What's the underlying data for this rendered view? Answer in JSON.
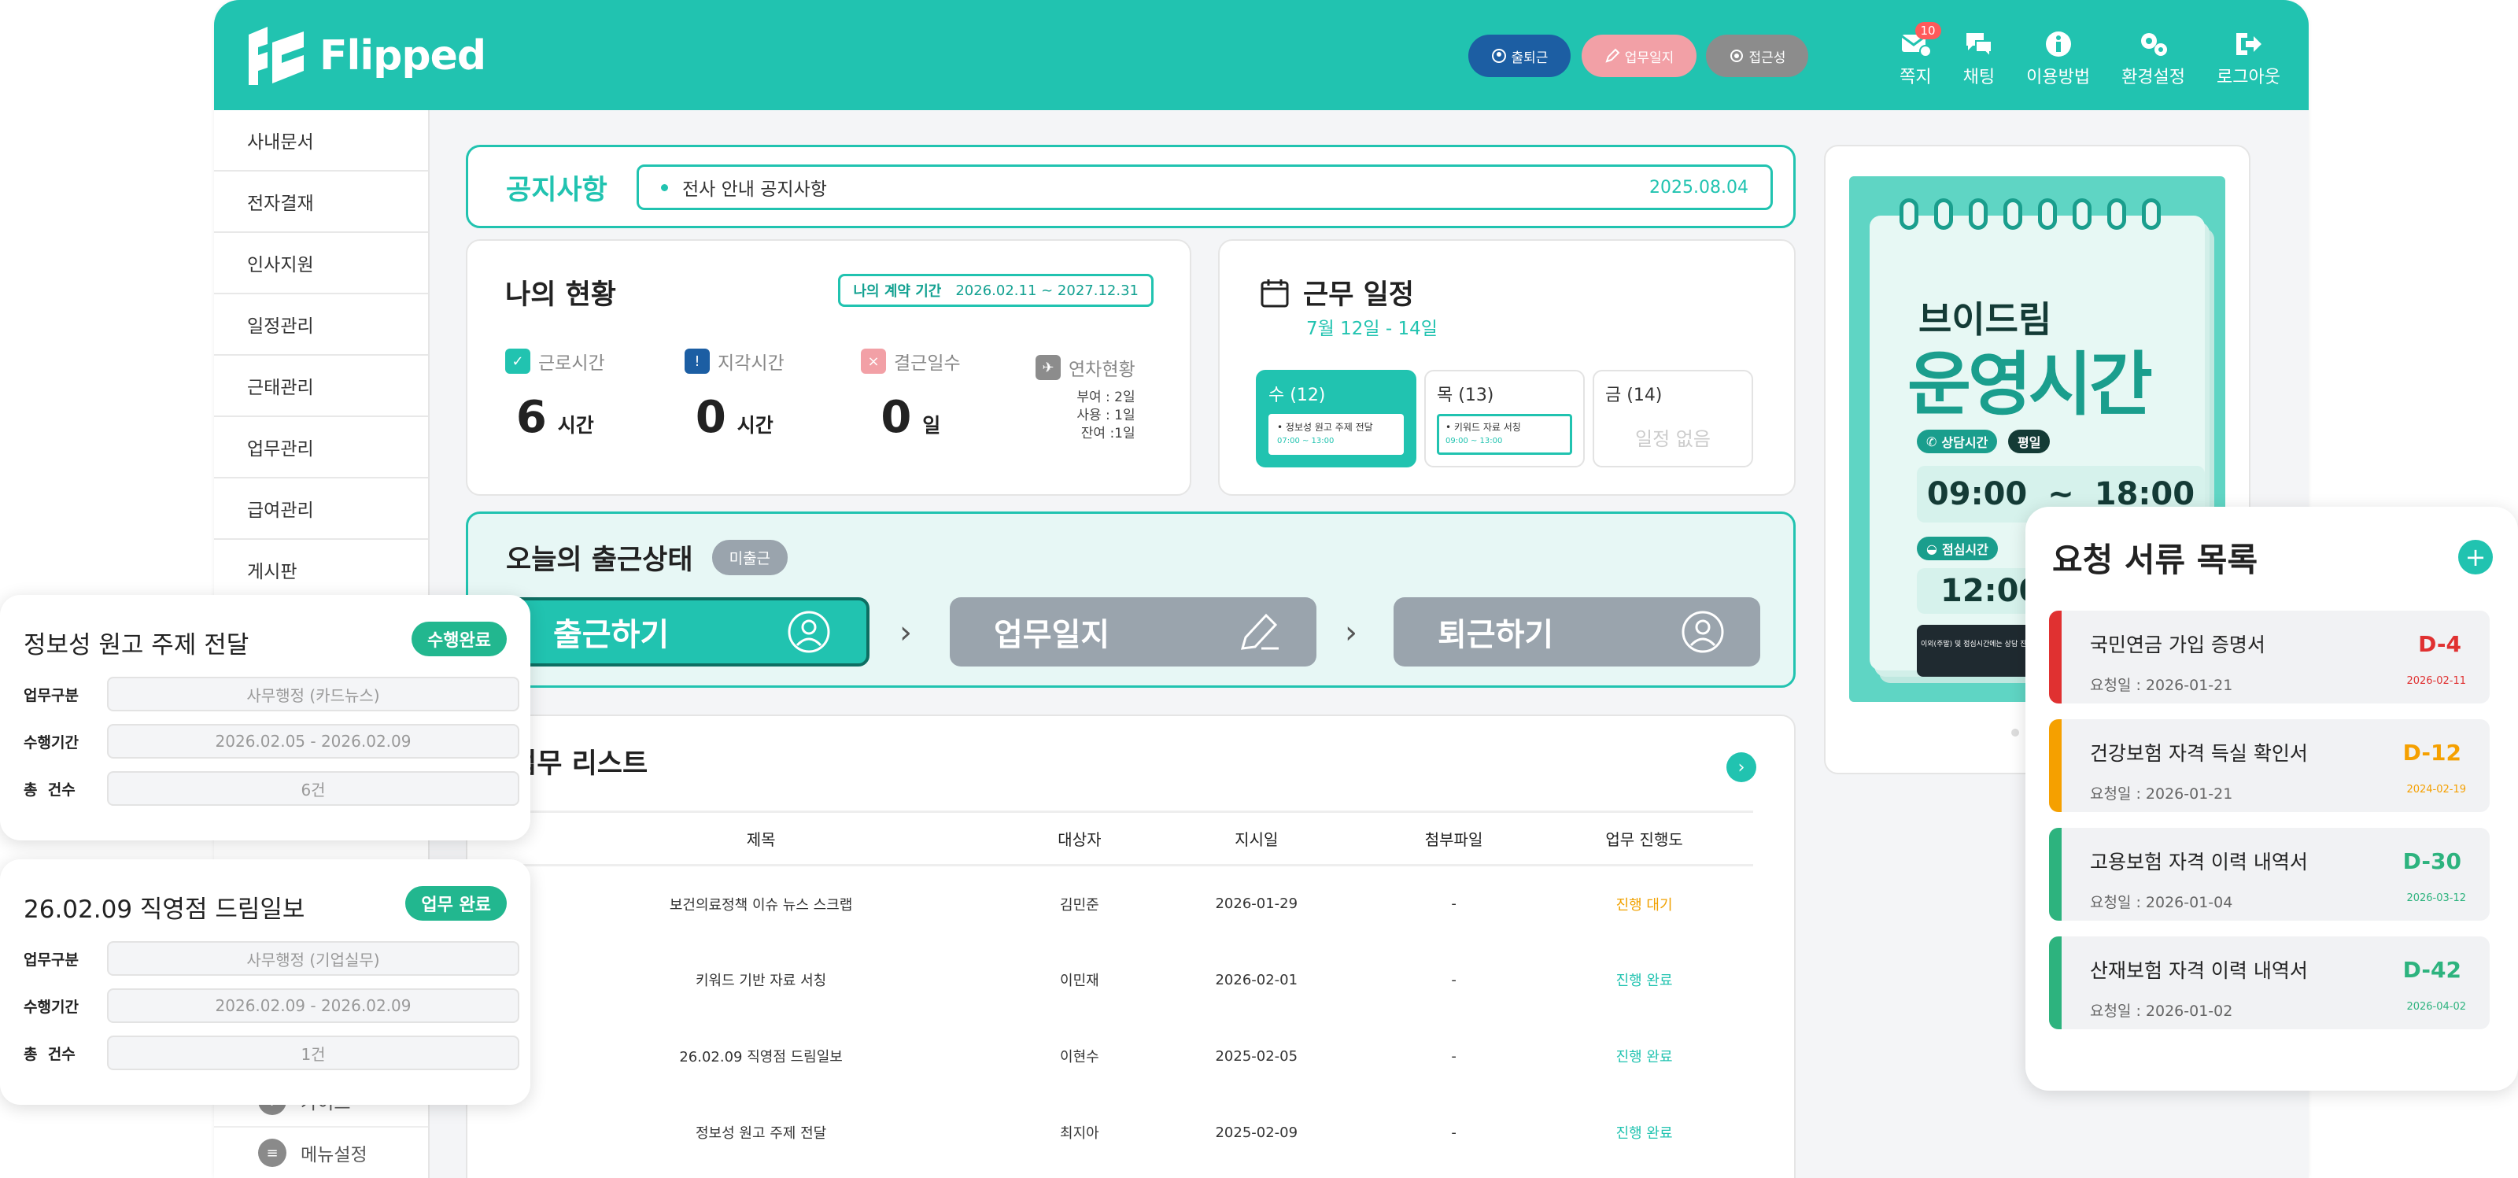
{
  "app": {
    "logo_text": "Flipped"
  },
  "header": {
    "pills": [
      {
        "label": "출퇴근",
        "color": "#1c5ea3"
      },
      {
        "label": "업무일지",
        "color": "#f2a0a6"
      },
      {
        "label": "접근성",
        "color": "#8c8c8c"
      }
    ],
    "nav": [
      {
        "label": "쪽지",
        "icon": "message-icon",
        "badge": "10"
      },
      {
        "label": "채팅",
        "icon": "chat-icon"
      },
      {
        "label": "이용방법",
        "icon": "info-icon"
      },
      {
        "label": "환경설정",
        "icon": "gear-icon"
      },
      {
        "label": "로그아웃",
        "icon": "logout-icon"
      }
    ]
  },
  "sidebar": {
    "items": [
      "사내문서",
      "전자결재",
      "인사지원",
      "일정관리",
      "근태관리",
      "업무관리",
      "급여관리",
      "게시판"
    ],
    "bottom": [
      {
        "label": "가이드",
        "icon": "guide-icon"
      },
      {
        "label": "메뉴설정",
        "icon": "menu-settings-icon"
      }
    ]
  },
  "notice": {
    "title": "공지사항",
    "text": "전사 안내 공지사항",
    "date": "2025.08.04"
  },
  "status": {
    "title": "나의 현황",
    "contract_label": "나의 계약 기간",
    "contract_period": "2026.02.11 ~ 2027.12.31",
    "work": {
      "label": "근로시간",
      "value": "6",
      "unit": "시간"
    },
    "late": {
      "label": "지각시간",
      "value": "0",
      "unit": "시간"
    },
    "absent": {
      "label": "결근일수",
      "value": "0",
      "unit": "일"
    },
    "leave": {
      "label": "연차현황",
      "granted": "부여 : 2일",
      "used": "사용 : 1일",
      "remaining": "잔여 :1일"
    }
  },
  "schedule": {
    "title": "근무 일정",
    "range": "7월 12일 - 14일",
    "days": [
      {
        "label": "수 (12)",
        "event": "정보성 원고 주제 전달",
        "time": "07:00 ~ 13:00"
      },
      {
        "label": "목 (13)",
        "event": "키워드 자료 서칭",
        "time": "09:00 ~ 13:00"
      },
      {
        "label": "금 (14)",
        "empty": "일정 없음"
      }
    ]
  },
  "attendance": {
    "title": "오늘의 출근상태",
    "badge": "미출근",
    "buttons": [
      "출근하기",
      "업무일지",
      "퇴근하기"
    ]
  },
  "tasks": {
    "title": "업무 리스트",
    "columns": [
      "제목",
      "대상자",
      "지시일",
      "첨부파일",
      "업무 진행도"
    ],
    "rows": [
      [
        "보건의료정책 이슈 뉴스 스크랩",
        "김민준",
        "2026-01-29",
        "-",
        "진행 대기"
      ],
      [
        "키워드 기반 자료 서칭",
        "이민재",
        "2026-02-01",
        "-",
        "진행 완료"
      ],
      [
        "26.02.09 직영점 드림일보",
        "이현수",
        "2025-02-05",
        "-",
        "진행 완료"
      ],
      [
        "정보성 원고 주제 전달",
        "최지아",
        "2025-02-09",
        "-",
        "진행 완료"
      ]
    ]
  },
  "promo": {
    "heading_small": "브이드림",
    "heading_big": "운영시간",
    "consult_tag": "상담시간",
    "weekday_tag": "평일",
    "consult_start": "09:00",
    "tilde": "~",
    "consult_end": "18:00",
    "lunch_tag": "점심시간",
    "lunch_start": "12:00",
    "footer": "이외(주말) 및 점심시간에는 상담 진행이 어렵습니다. 운영 시간 참고하시어 문의 부탁드립니다."
  },
  "float_cards": [
    {
      "title": "정보성 원고 주제 전달",
      "badge": "수행완료",
      "rows": [
        {
          "key": "업무구분",
          "value": "사무행정 (카드뉴스)"
        },
        {
          "key": "수행기간",
          "value": "2026.02.05 - 2026.02.09"
        },
        {
          "key": "총  건수",
          "value": "6건"
        }
      ]
    },
    {
      "title": "26.02.09 직영점 드림일보",
      "badge": "업무 완료",
      "rows": [
        {
          "key": "업무구분",
          "value": "사무행정 (기업실무)"
        },
        {
          "key": "수행기간",
          "value": "2026.02.09 - 2026.02.09"
        },
        {
          "key": "총  건수",
          "value": "1건"
        }
      ]
    }
  ],
  "requests": {
    "title": "요청 서류 목록",
    "add": "+",
    "items": [
      {
        "name": "국민연금 가입 증명서",
        "date": "요청일 : 2026-01-21",
        "dday": "D-4",
        "due": "2026-02-11",
        "color": "#e03131"
      },
      {
        "name": "건강보험 자격 득실 확인서",
        "date": "요청일 : 2026-01-21",
        "dday": "D-12",
        "due": "2024-02-19",
        "color": "#f5a000"
      },
      {
        "name": "고용보험 자격 이력 내역서",
        "date": "요청일 : 2026-01-04",
        "dday": "D-30",
        "due": "2026-03-12",
        "color": "#2db37e"
      },
      {
        "name": "산재보험 자격 이력 내역서",
        "date": "요청일 : 2026-01-02",
        "dday": "D-42",
        "due": "2026-04-02",
        "color": "#2db37e"
      }
    ]
  }
}
